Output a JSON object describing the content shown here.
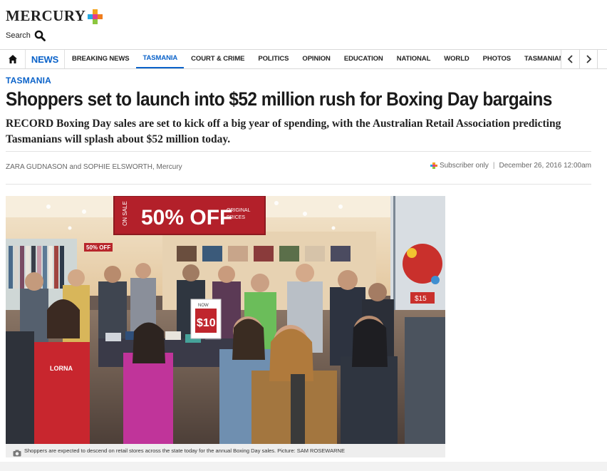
{
  "brand": {
    "logo_text": "MERCURY",
    "colors": {
      "accent_blue": "#0a62c9",
      "plus_orange": "#f07d1e",
      "plus_yellow": "#f3a21a",
      "plus_pink": "#e43c8b",
      "plus_blue": "#26a8e0",
      "plus_green": "#8cc63f"
    }
  },
  "search": {
    "label": "Search",
    "icon": "search-icon"
  },
  "nav": {
    "home_icon": "home-icon",
    "news_label": "NEWS",
    "items": [
      {
        "label": "BREAKING NEWS",
        "active": false
      },
      {
        "label": "TASMANIA",
        "active": true
      },
      {
        "label": "COURT & CRIME",
        "active": false
      },
      {
        "label": "POLITICS",
        "active": false
      },
      {
        "label": "OPINION",
        "active": false
      },
      {
        "label": "EDUCATION",
        "active": false
      },
      {
        "label": "NATIONAL",
        "active": false
      },
      {
        "label": "WORLD",
        "active": false
      },
      {
        "label": "PHOTOS",
        "active": false
      },
      {
        "label": "TASMANIAN COUNTRY",
        "active": false
      }
    ],
    "prev_icon": "chevron-left-icon",
    "next_icon": "chevron-right-icon"
  },
  "article": {
    "section": "TASMANIA",
    "headline": "Shoppers set to launch into $52 million rush for Boxing Day bargains",
    "standfirst": "RECORD Boxing Day sales are set to kick off a big year of spending, with the Australian Retail Association predicting Tasmanians will splash about $52 million today.",
    "byline": "ZARA GUDNASON and SOPHIE ELSWORTH, Mercury",
    "subscriber_label": "Subscriber only",
    "separator": "|",
    "date": "December 26, 2016 12:00am",
    "image": {
      "sign_main": "50% OFF",
      "sign_small_left": "ON SALE",
      "sign_small_right_1": "ORIGINAL",
      "sign_small_right_2": "PRICES",
      "price_tag": "$10",
      "price_tag_small": "NOW",
      "wall_sign": "50% OFF",
      "window_tag": "$15",
      "shirt_text": "LORNA"
    },
    "caption": "Shoppers are expected to descend on retail stores across the state today for the annual Boxing Day sales. Picture: SAM ROSEWARNE"
  }
}
